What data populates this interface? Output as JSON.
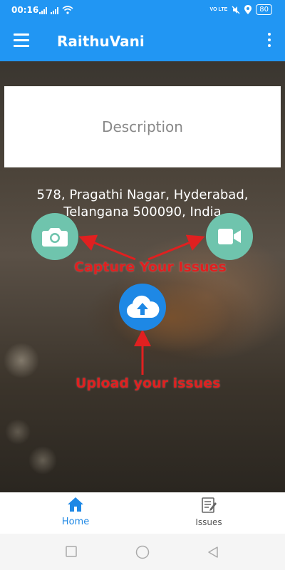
{
  "status": {
    "time": "00:16",
    "network_label": "VO LTE",
    "battery": "80"
  },
  "app_bar": {
    "title": "RaithuVani"
  },
  "main": {
    "description_label": "Description",
    "address_line1": "578, Pragathi Nagar, Hyderabad,",
    "address_line2": "Telangana 500090, India",
    "capture_label": "Capture Your Issues",
    "upload_label": "Upload your issues"
  },
  "bottom_nav": {
    "home_label": "Home",
    "issues_label": "Issues"
  },
  "colors": {
    "primary": "#2196f3",
    "accent_blue": "#1e88e5",
    "action_green": "#6fc4ad",
    "annotation_red": "#e02020"
  },
  "icons": [
    "menu-icon",
    "more-vert-icon",
    "camera-icon",
    "video-camera-icon",
    "cloud-upload-icon",
    "home-icon",
    "issues-icon"
  ]
}
